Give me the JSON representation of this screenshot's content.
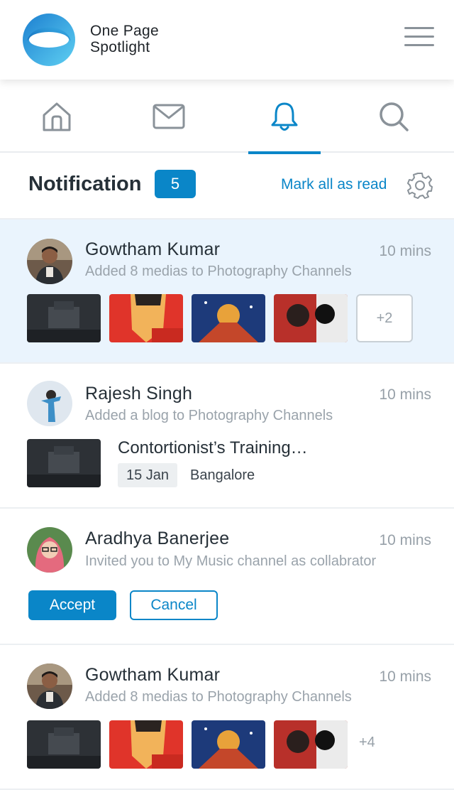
{
  "app": {
    "brand_line1": "One Page",
    "brand_line2": "Spotlight",
    "logo_icon": "ring-logo-icon",
    "menu_icon": "hamburger-menu-icon",
    "accent_color": "#0a86c8"
  },
  "tabs": [
    {
      "name": "home",
      "icon": "home-icon",
      "active": false
    },
    {
      "name": "messages",
      "icon": "mail-icon",
      "active": false
    },
    {
      "name": "notifications",
      "icon": "bell-icon",
      "active": true
    },
    {
      "name": "search",
      "icon": "search-icon",
      "active": false
    }
  ],
  "notifications_header": {
    "title": "Notification",
    "count": "5",
    "mark_all": "Mark all as read",
    "settings_icon": "gear-icon"
  },
  "notifications": [
    {
      "name": "Gowtham Kumar",
      "time": "10 mins",
      "text": "Added 8 medias to Photography Channels",
      "unread": true,
      "more": "+2"
    },
    {
      "name": "Rajesh Singh",
      "time": "10 mins",
      "text": "Added a blog to Photography Channels",
      "blog_title": "Contortionist’s Training…",
      "date": "15 Jan",
      "location": "Bangalore"
    },
    {
      "name": "Aradhya Banerjee",
      "time": "10 mins",
      "text": "Invited you to My Music channel as collabrator",
      "accept": "Accept",
      "cancel": "Cancel"
    },
    {
      "name": "Gowtham Kumar",
      "time": "10 mins",
      "text": "Added 8 medias to Photography Channels",
      "more": "+4"
    }
  ]
}
